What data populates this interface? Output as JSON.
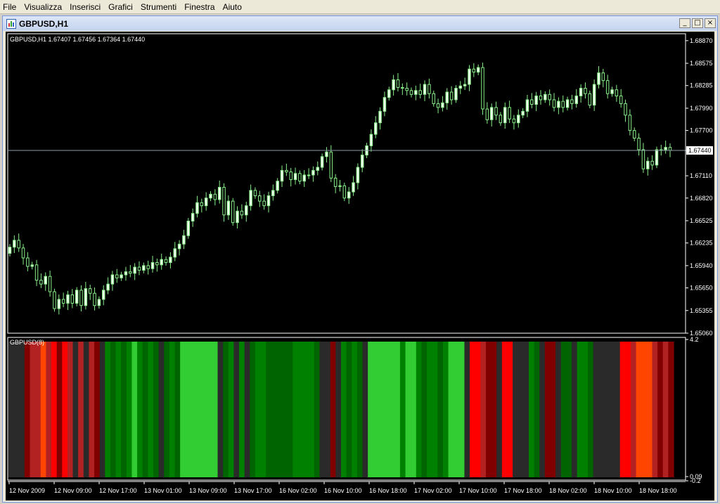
{
  "menu": [
    "File",
    "Visualizza",
    "Inserisci",
    "Grafici",
    "Strumenti",
    "Finestra",
    "Aiuto"
  ],
  "window": {
    "title": "GBPUSD,H1",
    "minimize": "_",
    "restore": "□",
    "close": "×"
  },
  "colors": {
    "background": "#000000",
    "axis": "#ffffff",
    "candle": "#88ee88",
    "bull_body": "#eeffee",
    "price_line": "#8a9ba8",
    "current_price_box": "#ffffff",
    "bar_palette": [
      "#2a2a2a",
      "#800000",
      "#b22222",
      "#ff0000",
      "#ff4500",
      "#006400",
      "#008000",
      "#32cd32"
    ]
  },
  "chart_data": [
    {
      "type": "candlestick",
      "title": "GBPUSD,H1  1.67407 1.67456 1.67364 1.67440",
      "symbol": "GBPUSD,H1",
      "ohlc": {
        "open": "1.67407",
        "high": "1.67456",
        "low": "1.67364",
        "close": "1.67440"
      },
      "y_ticks": [
        "1.68870",
        "1.68575",
        "1.68285",
        "1.67990",
        "1.67700",
        "1.67440",
        "1.67110",
        "1.66820",
        "1.66525",
        "1.66235",
        "1.65940",
        "1.65650",
        "1.65355",
        "1.65060"
      ],
      "ylim": [
        1.6506,
        1.6896
      ],
      "current_price": "1.67440",
      "x_ticks": [
        "12 Nov 2009",
        "12 Nov 09:00",
        "12 Nov 17:00",
        "13 Nov 01:00",
        "13 Nov 09:00",
        "13 Nov 17:00",
        "16 Nov 02:00",
        "16 Nov 10:00",
        "16 Nov 18:00",
        "17 Nov 02:00",
        "17 Nov 10:00",
        "17 Nov 18:00",
        "18 Nov 02:00",
        "18 Nov 10:00",
        "18 Nov 18:00"
      ],
      "closes": [
        1.6618,
        1.6627,
        1.6617,
        1.6604,
        1.6593,
        1.6595,
        1.6575,
        1.657,
        1.658,
        1.656,
        1.6538,
        1.655,
        1.6545,
        1.6556,
        1.6545,
        1.6562,
        1.6542,
        1.6564,
        1.6558,
        1.6542,
        1.655,
        1.6562,
        1.657,
        1.6582,
        1.6578,
        1.6582,
        1.6586,
        1.6584,
        1.6592,
        1.6588,
        1.6594,
        1.659,
        1.6598,
        1.6595,
        1.6602,
        1.6598,
        1.6605,
        1.6616,
        1.6622,
        1.6633,
        1.6652,
        1.6662,
        1.6676,
        1.6672,
        1.6682,
        1.6687,
        1.668,
        1.6696,
        1.666,
        1.6678,
        1.665,
        1.6665,
        1.666,
        1.6672,
        1.6692,
        1.6685,
        1.6678,
        1.6672,
        1.6685,
        1.6692,
        1.6704,
        1.6718,
        1.6716,
        1.6706,
        1.6714,
        1.6704,
        1.6712,
        1.6712,
        1.6718,
        1.6722,
        1.6736,
        1.6742,
        1.6708,
        1.6697,
        1.6698,
        1.6682,
        1.669,
        1.6702,
        1.6722,
        1.6738,
        1.675,
        1.6765,
        1.678,
        1.6795,
        1.6813,
        1.6823,
        1.6836,
        1.6826,
        1.6825,
        1.6822,
        1.6817,
        1.6822,
        1.6817,
        1.683,
        1.6818,
        1.6805,
        1.68,
        1.6806,
        1.682,
        1.681,
        1.6825,
        1.6828,
        1.683,
        1.685,
        1.6846,
        1.6852,
        1.6798,
        1.6784,
        1.68,
        1.679,
        1.678,
        1.68,
        1.6785,
        1.678,
        1.679,
        1.6795,
        1.681,
        1.6804,
        1.6815,
        1.681,
        1.6817,
        1.681,
        1.68,
        1.6808,
        1.68,
        1.681,
        1.6805,
        1.6815,
        1.6825,
        1.6818,
        1.6803,
        1.683,
        1.6845,
        1.6835,
        1.6818,
        1.6823,
        1.6815,
        1.6805,
        1.679,
        1.677,
        1.676,
        1.6745,
        1.672,
        1.673,
        1.6725,
        1.6745,
        1.6745,
        1.6748,
        1.6744
      ]
    },
    {
      "type": "heatmap",
      "title": "GBPUSD(8)",
      "y_ticks": [
        "4.2",
        "0.09",
        "-0.2"
      ],
      "bar_color_index": [
        0,
        0,
        0,
        1,
        2,
        2,
        4,
        2,
        3,
        1,
        3,
        2,
        0,
        2,
        0,
        2,
        1,
        0,
        6,
        5,
        6,
        5,
        6,
        7,
        6,
        5,
        6,
        5,
        0,
        5,
        6,
        5,
        7,
        7,
        7,
        7,
        7,
        7,
        7,
        0,
        5,
        6,
        0,
        6,
        0,
        5,
        6,
        6,
        5,
        5,
        5,
        5,
        5,
        6,
        6,
        6,
        6,
        5,
        0,
        0,
        1,
        0,
        6,
        5,
        6,
        5,
        0,
        7,
        7,
        7,
        7,
        7,
        7,
        6,
        7,
        7,
        6,
        5,
        6,
        6,
        5,
        6,
        7,
        7,
        7,
        0,
        3,
        3,
        2,
        1,
        1,
        0,
        3,
        3,
        0,
        0,
        0,
        6,
        5,
        0,
        1,
        1,
        0,
        5,
        5,
        0,
        6,
        6,
        5,
        0,
        0,
        0,
        0,
        0,
        3,
        3,
        2,
        4,
        4,
        4,
        2,
        1,
        2,
        1
      ]
    }
  ]
}
